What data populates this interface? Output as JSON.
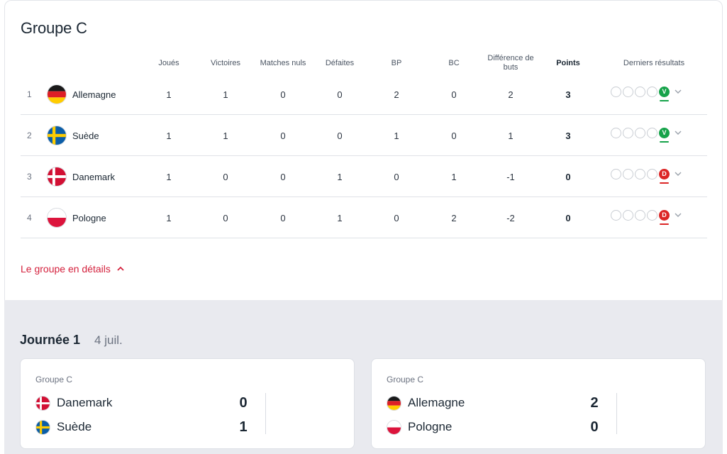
{
  "group": {
    "title": "Groupe C"
  },
  "table": {
    "headers": {
      "played": "Joués",
      "wins": "Victoires",
      "draws": "Matches nuls",
      "losses": "Défaites",
      "gf": "BP",
      "ga": "BC",
      "diff": "Différence de buts",
      "points": "Points",
      "form": "Derniers résultats"
    },
    "rows": [
      {
        "rank": "1",
        "team": "Allemagne",
        "flag": "germany-flag-icon",
        "played": "1",
        "wins": "1",
        "draws": "0",
        "losses": "0",
        "gf": "2",
        "ga": "0",
        "diff": "2",
        "points": "3",
        "last": "V"
      },
      {
        "rank": "2",
        "team": "Suède",
        "flag": "sweden-flag-icon",
        "played": "1",
        "wins": "1",
        "draws": "0",
        "losses": "0",
        "gf": "1",
        "ga": "0",
        "diff": "1",
        "points": "3",
        "last": "V"
      },
      {
        "rank": "3",
        "team": "Danemark",
        "flag": "denmark-flag-icon",
        "played": "1",
        "wins": "0",
        "draws": "0",
        "losses": "1",
        "gf": "0",
        "ga": "1",
        "diff": "-1",
        "points": "0",
        "last": "D"
      },
      {
        "rank": "4",
        "team": "Pologne",
        "flag": "poland-flag-icon",
        "played": "1",
        "wins": "0",
        "draws": "0",
        "losses": "1",
        "gf": "0",
        "ga": "2",
        "diff": "-2",
        "points": "0",
        "last": "D"
      }
    ]
  },
  "details_link": "Le groupe en détails",
  "matchday": {
    "title": "Journée 1",
    "date": "4 juil.",
    "matches": [
      {
        "group": "Groupe C",
        "home": "Danemark",
        "home_score": "0",
        "away": "Suède",
        "away_score": "1"
      },
      {
        "group": "Groupe C",
        "home": "Allemagne",
        "home_score": "2",
        "away": "Pologne",
        "away_score": "0"
      }
    ]
  },
  "colors": {
    "win": "#16a34a",
    "loss": "#dc2626",
    "accent": "#d4213d",
    "background": "#e9eaef"
  }
}
